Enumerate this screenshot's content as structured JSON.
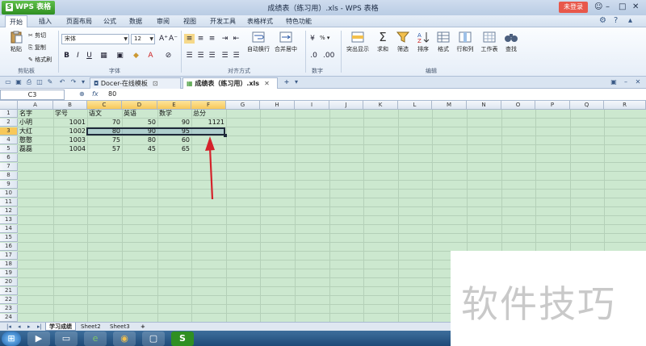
{
  "titlebar": {
    "app_button": "WPS 表格",
    "title": "成绩表（练习用）.xls - WPS 表格",
    "login": "未登录"
  },
  "menu": {
    "items": [
      "开始",
      "插入",
      "页面布局",
      "公式",
      "数据",
      "审阅",
      "视图",
      "开发工具",
      "表格样式",
      "特色功能"
    ]
  },
  "ribbon": {
    "paste": "粘贴",
    "cut": "剪切",
    "copy": "复制",
    "format_painter": "格式刷",
    "font_name": "宋体",
    "font_size": "12",
    "wrap_text": "自动换行",
    "merge_center": "合并居中",
    "number_format": "% ▾",
    "convert": "突出显示",
    "sum": "求和",
    "filter": "筛选",
    "sort": "排序",
    "format": "格式",
    "rows_cols": "行和列",
    "worksheet": "工作表",
    "find": "查找",
    "groups": {
      "clipboard": "剪贴板",
      "font": "字体",
      "alignment": "对齐方式",
      "number": "数字",
      "edit": "编辑"
    }
  },
  "tabs": {
    "docer": "Docer-在线模板",
    "file": "成绩表（练习用）.xls"
  },
  "formula": {
    "name_box": "C3",
    "value": "80"
  },
  "sheet": {
    "columns": [
      "A",
      "B",
      "C",
      "D",
      "E",
      "F",
      "G",
      "H",
      "I",
      "J",
      "K",
      "L",
      "M",
      "N",
      "O",
      "P",
      "Q",
      "R"
    ],
    "rows": [
      "1",
      "2",
      "3",
      "4",
      "5",
      "6",
      "7",
      "8",
      "9",
      "10",
      "11",
      "12",
      "13",
      "14",
      "15",
      "16",
      "17",
      "18",
      "19",
      "20",
      "21",
      "22",
      "23",
      "24",
      "25"
    ],
    "headers": [
      "名字",
      "学号",
      "语文",
      "英语",
      "数学",
      "总分"
    ],
    "data": [
      [
        "小明",
        "1001",
        "70",
        "50",
        "90",
        "1121"
      ],
      [
        "大红",
        "1002",
        "80",
        "90",
        "95",
        ""
      ],
      [
        "憨憨",
        "1003",
        "75",
        "80",
        "60",
        ""
      ],
      [
        "磊磊",
        "1004",
        "57",
        "45",
        "65",
        ""
      ]
    ]
  },
  "sheet_tabs": [
    "学习成绩",
    "Sheet2",
    "Sheet3"
  ],
  "watermark": "软件技巧",
  "colors": {
    "grid_bg": "#cce8cf",
    "arrow": "#d4232b",
    "accent": "#2f8f22"
  }
}
